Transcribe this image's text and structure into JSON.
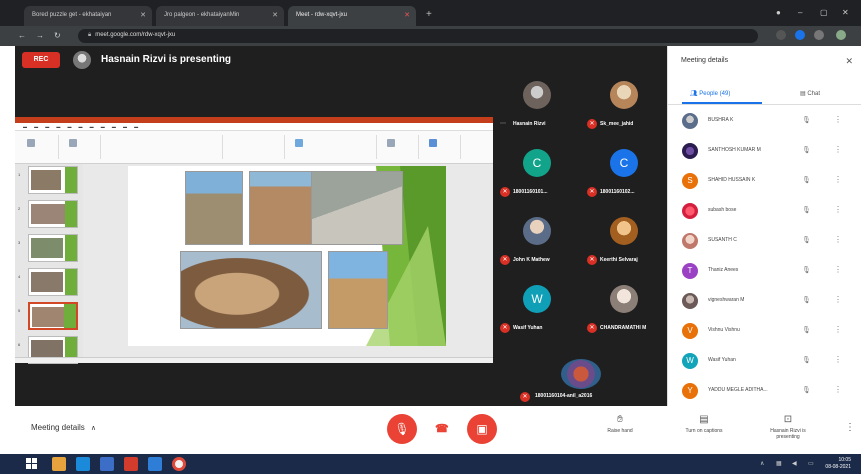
{
  "browser": {
    "tabs": [
      {
        "title": "Bored puzzle get - ekhataiyan",
        "active": false
      },
      {
        "title": "Jro palgeon - ekhataiyanMin",
        "active": false
      },
      {
        "title": "Meet - rdw-xqvt-jxu",
        "active": true
      }
    ],
    "url": "meet.google.com/rdw-xqvt-jxu",
    "new_tab": "+",
    "window_controls": [
      "–",
      "▢",
      "✕"
    ]
  },
  "meet": {
    "rec_label": "REC",
    "presenting_text": "Hasnain Rizvi is presenting"
  },
  "tiles": [
    {
      "name": "Hasnain Rizvi",
      "initial": "",
      "color": "#8a7f76",
      "mic": "more"
    },
    {
      "name": "Sk_mee_jahid",
      "initial": "",
      "color": "#c49a6c",
      "mic": "muted"
    },
    {
      "name": "18001160101...",
      "initial": "C",
      "color": "#12a48b",
      "mic": "muted"
    },
    {
      "name": "18001160102...",
      "initial": "C",
      "color": "#1a73e8",
      "mic": "muted"
    },
    {
      "name": "John K Mathew",
      "initial": "",
      "color": "#7f8a99",
      "mic": "muted"
    },
    {
      "name": "Keerthi Selvaraj",
      "initial": "",
      "color": "#c98a3a",
      "mic": "muted"
    },
    {
      "name": "Wasif Yuhan",
      "initial": "W",
      "color": "#0fa0b8",
      "mic": "muted"
    },
    {
      "name": "CHANDRAMATHI M",
      "initial": "",
      "color": "#9a8f8a",
      "mic": "muted"
    }
  ],
  "last_tile": {
    "name": "18001160104-anil_a2016"
  },
  "panel": {
    "title": "Meeting details",
    "tabs": {
      "people": "People (49)",
      "chat": "Chat"
    },
    "participants": [
      {
        "name": "BUSHRA K",
        "initial": "",
        "color": "#5a6d8a"
      },
      {
        "name": "SANTHOSH KUMAR M",
        "initial": "",
        "color": "#3c2a6b"
      },
      {
        "name": "SHAHID HUSSAIN K",
        "initial": "S",
        "color": "#e8710a"
      },
      {
        "name": "subash bose",
        "initial": "",
        "color": "#e53950"
      },
      {
        "name": "SUSANTH C",
        "initial": "",
        "color": "#c0786a"
      },
      {
        "name": "Thaniz Anees",
        "initial": "T",
        "color": "#9b42c4"
      },
      {
        "name": "vigneshwaran M",
        "initial": "",
        "color": "#6b5a57"
      },
      {
        "name": "Vishnu Vishnu",
        "initial": "V",
        "color": "#e8710a"
      },
      {
        "name": "Wasif Yuhan",
        "initial": "W",
        "color": "#12a4b8"
      },
      {
        "name": "YADDU MEGLE ADITHA...",
        "initial": "Y",
        "color": "#e8710a"
      }
    ]
  },
  "bottom": {
    "meeting_details": "Meeting details",
    "raise_hand": "Raise hand",
    "captions": "Turn on captions",
    "presenting": "Hasnain Rizvi is presenting"
  },
  "taskbar": {
    "time": "10:05",
    "date": "08-08-2021"
  },
  "colors": {
    "accent": "#1a73e8",
    "danger": "#ea4335",
    "meet_bg": "#1f1f1f"
  }
}
